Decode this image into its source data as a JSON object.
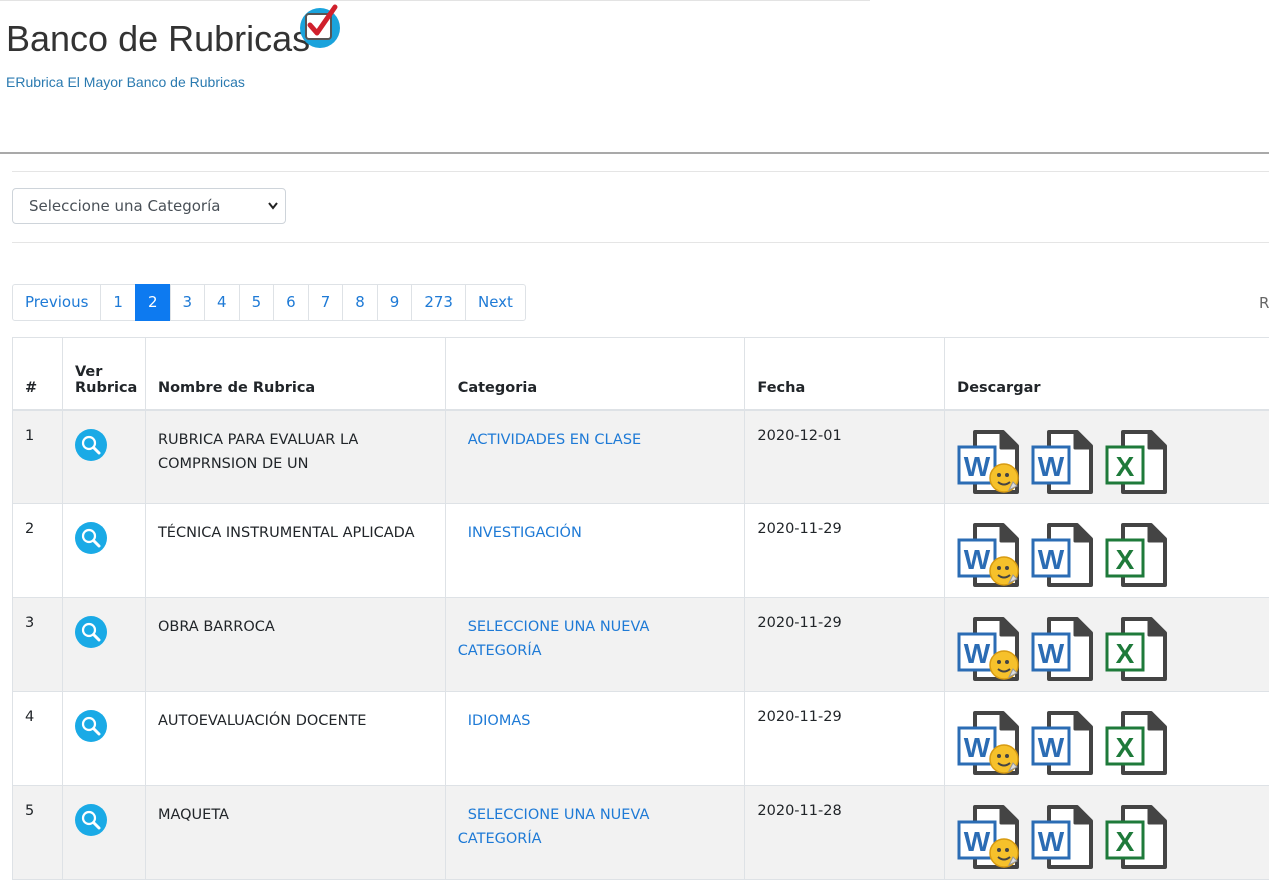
{
  "header": {
    "title": "Banco de Rubricas",
    "subtitle": "ERubrica El Mayor Banco de Rubricas"
  },
  "filter": {
    "select_value": "Seleccione una Categoría"
  },
  "pagination": {
    "previous": "Previous",
    "pages": [
      "1",
      "2",
      "3",
      "4",
      "5",
      "6",
      "7",
      "8",
      "9",
      "273"
    ],
    "active": "2",
    "next": "Next",
    "cut_text": "R"
  },
  "table": {
    "headers": [
      "#",
      "Ver Rubrica",
      "Nombre de Rubrica",
      "Categoria",
      "Fecha",
      "Descargar"
    ],
    "rows": [
      {
        "num": "1",
        "name": "RUBRICA PARA EVALUAR LA COMPRNSION DE UN",
        "category": "ACTIVIDADES EN CLASE",
        "date": "2020-12-01"
      },
      {
        "num": "2",
        "name": "TÉCNICA INSTRUMENTAL APLICADA",
        "category": "INVESTIGACIÓN",
        "date": "2020-11-29"
      },
      {
        "num": "3",
        "name": "OBRA BARROCA",
        "category": "SELECCIONE UNA NUEVA CATEGORÍA",
        "date": "2020-11-29"
      },
      {
        "num": "4",
        "name": "AUTOEVALUACIÓN DOCENTE",
        "category": "IDIOMAS",
        "date": "2020-11-29"
      },
      {
        "num": "5",
        "name": "MAQUETA",
        "category": "SELECCIONE UNA NUEVA CATEGORÍA",
        "date": "2020-11-28"
      }
    ]
  },
  "icons": {
    "logo": "checkbox-check-icon",
    "view": "magnifier-icon",
    "downloads": [
      "word-edit-icon",
      "word-icon",
      "excel-icon"
    ]
  },
  "colors": {
    "link": "#1e7ad6",
    "active_page": "#0d7af0",
    "view_button": "#1aaae6",
    "word": "#2b6cb4",
    "excel": "#1e7a3a"
  }
}
